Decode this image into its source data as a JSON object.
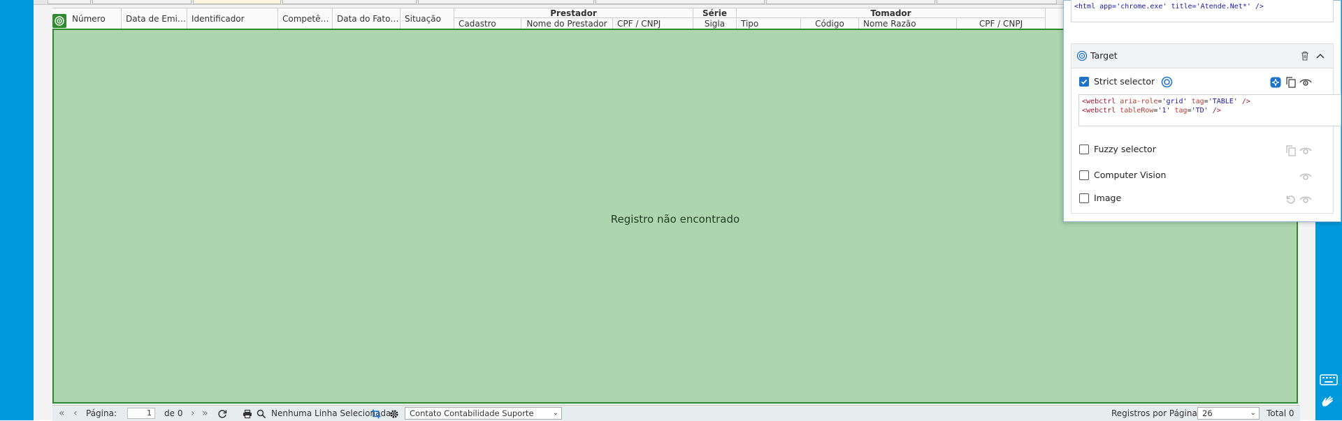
{
  "grid": {
    "columns": [
      "Número",
      "Data de Emis...",
      "Identificador",
      "Competên...",
      "Data do Fato ...",
      "Situação"
    ],
    "groups": [
      {
        "label": "Prestador",
        "subs": [
          "Cadastro",
          "Nome do Prestador",
          "CPF / CNPJ"
        ]
      },
      {
        "label": "Série",
        "subs": [
          "Sigla"
        ]
      },
      {
        "label": "Tomador",
        "subs": [
          "Tipo",
          "Código",
          "Nome Razão",
          "CPF / CNPJ"
        ]
      }
    ],
    "empty_message": "Registro não encontrado"
  },
  "footer": {
    "page_label": "Página:",
    "page_value": "1",
    "page_of": "de 0",
    "selection_status": "Nenhuma Linha Selecionada",
    "filter_selected": "Contato Contabilidade Suporte",
    "per_page_label": "Registros por Página:",
    "per_page_value": "26",
    "total": "Total 0"
  },
  "panel": {
    "top_code": "<html app='chrome.exe' title='Atende.Net*' />",
    "title": "Target",
    "strict_label": "Strict selector",
    "strict_checked": true,
    "strict_code": {
      "line1": {
        "tag": "webctrl",
        "a1": "aria-role",
        "v1": "'grid'",
        "a2": "tag",
        "v2": "'TABLE'"
      },
      "line2": {
        "tag": "webctrl",
        "a1": "tableRow",
        "v1": "'1'",
        "a2": "tag",
        "v2": "'TD'"
      }
    },
    "fuzzy_label": "Fuzzy selector",
    "cv_label": "Computer Vision",
    "image_label": "Image"
  },
  "colors": {
    "accent_blue": "#0099db",
    "empty_bg": "#add6ae",
    "empty_border": "#2f8a2f",
    "check_blue": "#1e73c8"
  }
}
